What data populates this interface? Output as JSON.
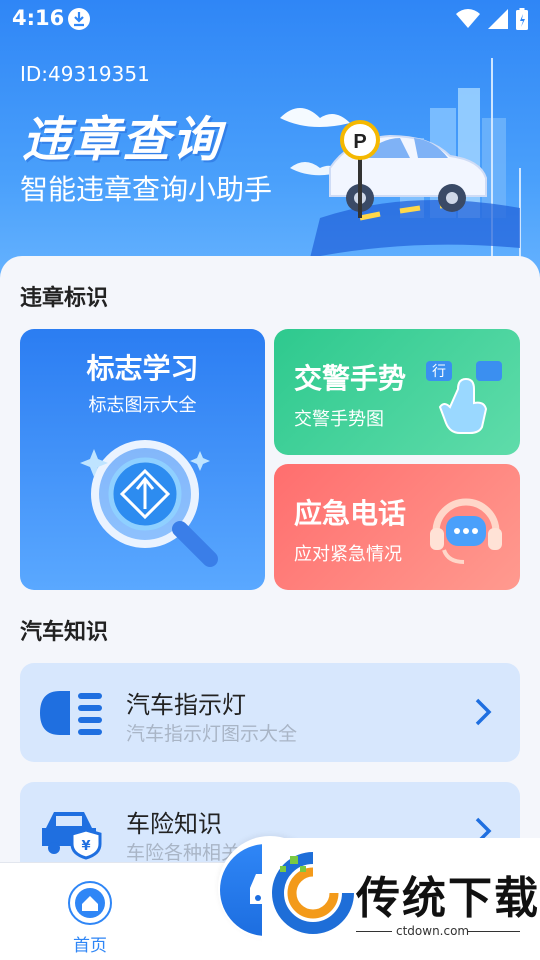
{
  "status": {
    "time": "4:16"
  },
  "header": {
    "id_text": "ID:49319351",
    "title": "违章查询",
    "subtitle": "智能违章查询小助手"
  },
  "sections": {
    "violation_signs": "违章标识",
    "car_knowledge": "汽车知识"
  },
  "cards": {
    "signs": {
      "title": "标志学习",
      "subtitle": "标志图示大全"
    },
    "police": {
      "title": "交警手势",
      "subtitle": "交警手势图",
      "badge_left": "行"
    },
    "emergency": {
      "title": "应急电话",
      "subtitle": "应对紧急情况"
    }
  },
  "rows": [
    {
      "title": "汽车指示灯",
      "subtitle": "汽车指示灯图示大全",
      "icon": "headlight-icon"
    },
    {
      "title": "车险知识",
      "subtitle": "车险各种相关",
      "icon": "car-insurance-icon"
    }
  ],
  "nav": {
    "home_label": "首页"
  },
  "watermark": {
    "text": "传统下载",
    "url": "ctdown.com"
  },
  "colors": {
    "primary": "#2f86f6",
    "green": "#2ec98e",
    "red": "#ff6e6e",
    "row_bg": "#d7e7fd"
  }
}
